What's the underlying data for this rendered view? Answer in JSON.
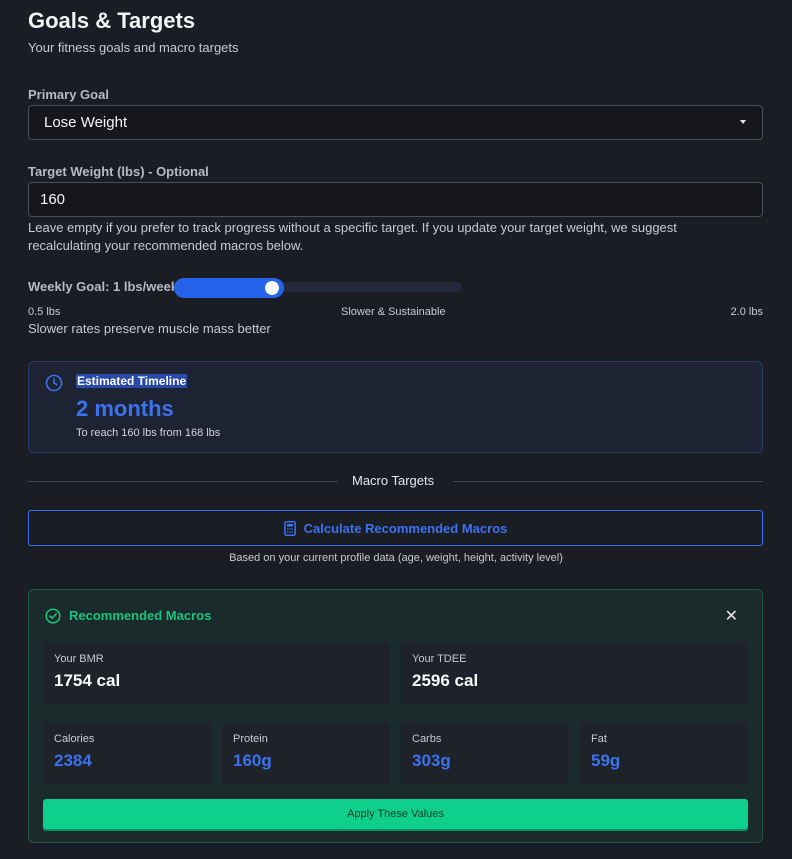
{
  "header": {
    "title": "Goals & Targets",
    "subtitle": "Your fitness goals and macro targets"
  },
  "primary_goal": {
    "label": "Primary Goal",
    "selected": "Lose Weight"
  },
  "target_weight": {
    "label": "Target Weight (lbs) - Optional",
    "value": "160",
    "help": "Leave empty if you prefer to track progress without a specific target. If you update your target weight, we suggest recalculating your recommended macros below."
  },
  "weekly_goal": {
    "label": "Weekly Goal: 1 lbs/week",
    "value": 1.0,
    "min": 0.5,
    "max": 2.0,
    "min_label": "0.5 lbs",
    "mid_label": "Slower & Sustainable",
    "max_label": "2.0 lbs",
    "note": "Slower rates preserve muscle mass better"
  },
  "timeline": {
    "title": "Estimated Timeline",
    "value": "2 months",
    "subtitle": "To reach 160 lbs from 168 lbs"
  },
  "macro_section": {
    "divider_label": "Macro Targets",
    "calculate_label": "Calculate Recommended Macros",
    "based_on": "Based on your current profile data (age, weight, height, activity level)"
  },
  "recommended": {
    "title": "Recommended Macros",
    "bmr_label": "Your BMR",
    "bmr_value": "1754 cal",
    "tdee_label": "Your TDEE",
    "tdee_value": "2596 cal",
    "macros": [
      {
        "label": "Calories",
        "value": "2384"
      },
      {
        "label": "Protein",
        "value": "160g"
      },
      {
        "label": "Carbs",
        "value": "303g"
      },
      {
        "label": "Fat",
        "value": "59g"
      }
    ],
    "apply_label": "Apply These Values"
  },
  "colors": {
    "background": "#1a1d23",
    "accent_blue": "#3b72f0",
    "accent_green": "#19c47e",
    "apply_button": "#0fcf8c"
  }
}
